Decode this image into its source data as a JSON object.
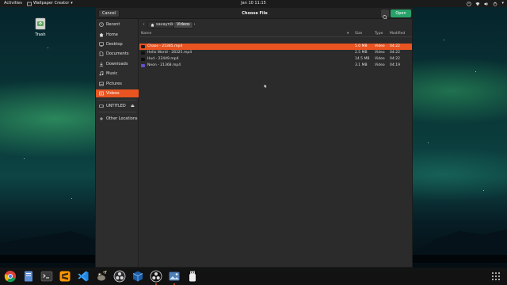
{
  "topbar": {
    "activities": "Activities",
    "app_name": "Wallpaper Creator",
    "clock": "Jan 10  11:15",
    "tray_icons": [
      "accessibility-icon",
      "network-icon",
      "volume-icon",
      "power-icon"
    ]
  },
  "desktop": {
    "trash_label": "Trash"
  },
  "dialog": {
    "title": "Choose File",
    "cancel_label": "Cancel",
    "open_label": "Open",
    "accent_color": "#e95420",
    "open_color": "#26a269"
  },
  "sidebar": {
    "items": [
      {
        "label": "Recent",
        "icon": "clock-icon"
      },
      {
        "label": "Home",
        "icon": "home-icon"
      },
      {
        "label": "Desktop",
        "icon": "desktop-icon"
      },
      {
        "label": "Documents",
        "icon": "document-icon"
      },
      {
        "label": "Downloads",
        "icon": "download-icon"
      },
      {
        "label": "Music",
        "icon": "music-icon"
      },
      {
        "label": "Pictures",
        "icon": "picture-icon"
      },
      {
        "label": "Videos",
        "icon": "video-icon",
        "active": true
      }
    ],
    "devices": [
      {
        "label": "UNTITLED",
        "icon": "drive-icon",
        "eject": "⏏"
      }
    ],
    "other_locations": {
      "label": "Other Locations",
      "icon": "plus-icon"
    }
  },
  "pathbar": {
    "home_crumb": "savaynik",
    "current_crumb": "Videos"
  },
  "file_list": {
    "columns": {
      "name": "Name",
      "size": "Size",
      "type": "Type",
      "modified": "Modified"
    },
    "rows": [
      {
        "name": "Chaos - 25385.mp4",
        "size": "5.0 MB",
        "type": "Video",
        "modified": "04:22",
        "selected": true
      },
      {
        "name": "Hello World - 28325.mp4",
        "size": "2.5 MB",
        "type": "Video",
        "modified": "04:22"
      },
      {
        "name": "Hud - 22449.mp4",
        "size": "14.5 MB",
        "type": "Video",
        "modified": "04:22"
      },
      {
        "name": "Neon - 21368.mp4",
        "size": "3.1 MB",
        "type": "Video",
        "modified": "04:19"
      }
    ]
  },
  "dock": {
    "apps": [
      "chrome-icon",
      "files-icon",
      "terminal-icon",
      "sublime-text-icon",
      "vscode-icon",
      "gimp-icon",
      "obs-icon",
      "virtualbox-icon",
      "obs-studio-icon",
      "wallpaper-creator-icon",
      "usb-creator-icon"
    ],
    "show_apps": "show-applications-icon"
  }
}
